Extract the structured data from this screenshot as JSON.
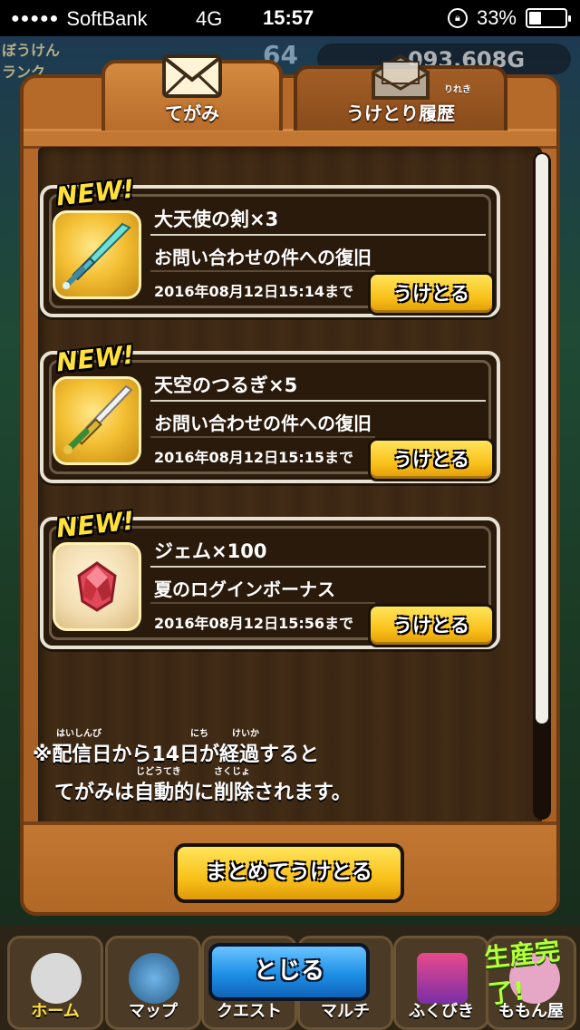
{
  "status_bar": {
    "carrier": "SoftBank",
    "network": "4G",
    "time": "15:57",
    "battery_percent": "33%",
    "battery_level": 0.33
  },
  "background": {
    "level": "64",
    "gold": "093,608G",
    "hud_label": "ぼうけんランク"
  },
  "tabs": [
    {
      "label": "てがみ",
      "active": true,
      "icon": "envelope-icon"
    },
    {
      "label": "うけとり履歴",
      "ruby": "りれき",
      "active": false,
      "icon": "opened-envelope-icon"
    }
  ],
  "mails": [
    {
      "badge": "NEW!",
      "title": "大天使の剣×3",
      "description": "お問い合わせの件への復旧",
      "deadline": "2016年08月12日15:14まで",
      "button": "うけとる",
      "icon": "archangel-sword-icon"
    },
    {
      "badge": "NEW!",
      "title": "天空のつるぎ×5",
      "description": "お問い合わせの件への復旧",
      "deadline": "2016年08月12日15:15まで",
      "button": "うけとる",
      "icon": "sky-sword-icon"
    },
    {
      "badge": "NEW!",
      "title": "ジェム×100",
      "description": "夏のログインボーナス",
      "deadline": "2016年08月12日15:56まで",
      "button": "うけとる",
      "icon": "gem-icon"
    }
  ],
  "notice": {
    "line1": "※配信日から14日が経過すると",
    "line2": "てがみは自動的に削除されます。",
    "furigana": {
      "haishinbi": "はいしんび",
      "nichi": "にち",
      "keika": "けいか",
      "jidouteki": "じどうてき",
      "sakujo": "さくじょ"
    }
  },
  "buttons": {
    "receive_all": "まとめてうけとる",
    "close": "とじる"
  },
  "bottom_nav": [
    {
      "label": "ホーム"
    },
    {
      "label": "マップ"
    },
    {
      "label": "クエスト"
    },
    {
      "label": "マルチ"
    },
    {
      "label": "ふくびき"
    },
    {
      "label": "ももん屋"
    }
  ],
  "production_done": "生産完了!",
  "colors": {
    "panel_wood": "#b66a2a",
    "panel_dark": "#3a2613",
    "button_gold": "#f9c11a",
    "button_blue": "#1d8fe6",
    "new_badge": "#ffe13a"
  }
}
